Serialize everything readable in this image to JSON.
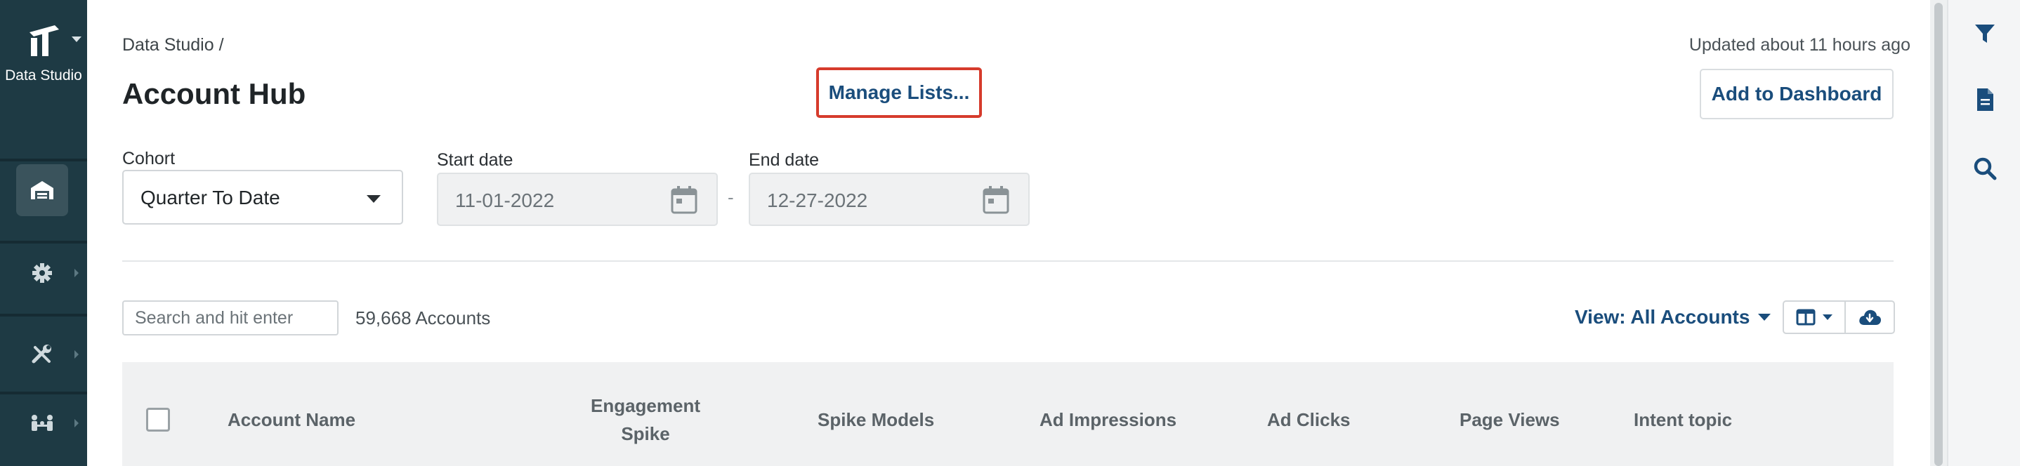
{
  "nav": {
    "app_label": "Data Studio",
    "items": [
      {
        "icon": "warehouse-icon",
        "active": true
      },
      {
        "icon": "gear-icon",
        "active": false
      },
      {
        "icon": "tools-icon",
        "active": false
      },
      {
        "icon": "people-network-icon",
        "active": false
      }
    ]
  },
  "header": {
    "breadcrumb": "Data Studio /",
    "title": "Account Hub",
    "updated": "Updated about 11 hours ago",
    "manage_label": "Manage Lists...",
    "dashboard_label": "Add to Dashboard"
  },
  "filters": {
    "cohort_label": "Cohort",
    "cohort_value": "Quarter To Date",
    "start_label": "Start date",
    "start_value": "11-01-2022",
    "end_label": "End date",
    "end_value": "12-27-2022",
    "range_separator": "-"
  },
  "toolbar": {
    "search_placeholder": "Search and hit enter",
    "count": "59,668 Accounts",
    "view_label": "View: All Accounts"
  },
  "table": {
    "columns": [
      {
        "line1": "Account Name",
        "line2": ""
      },
      {
        "line1": "Engagement",
        "line2": "Spike"
      },
      {
        "line1": "Spike Models",
        "line2": ""
      },
      {
        "line1": "Ad Impressions",
        "line2": ""
      },
      {
        "line1": "Ad Clicks",
        "line2": ""
      },
      {
        "line1": "Page Views",
        "line2": ""
      },
      {
        "line1": "Intent topic",
        "line2": ""
      }
    ]
  },
  "colors": {
    "nav_bg": "#1e3a44",
    "accent": "#1a4d7c",
    "highlight": "#d63b2c",
    "header_bg": "#f0f1f2"
  },
  "rail": {
    "icons": [
      "filter-icon",
      "document-icon",
      "search-icon"
    ]
  }
}
